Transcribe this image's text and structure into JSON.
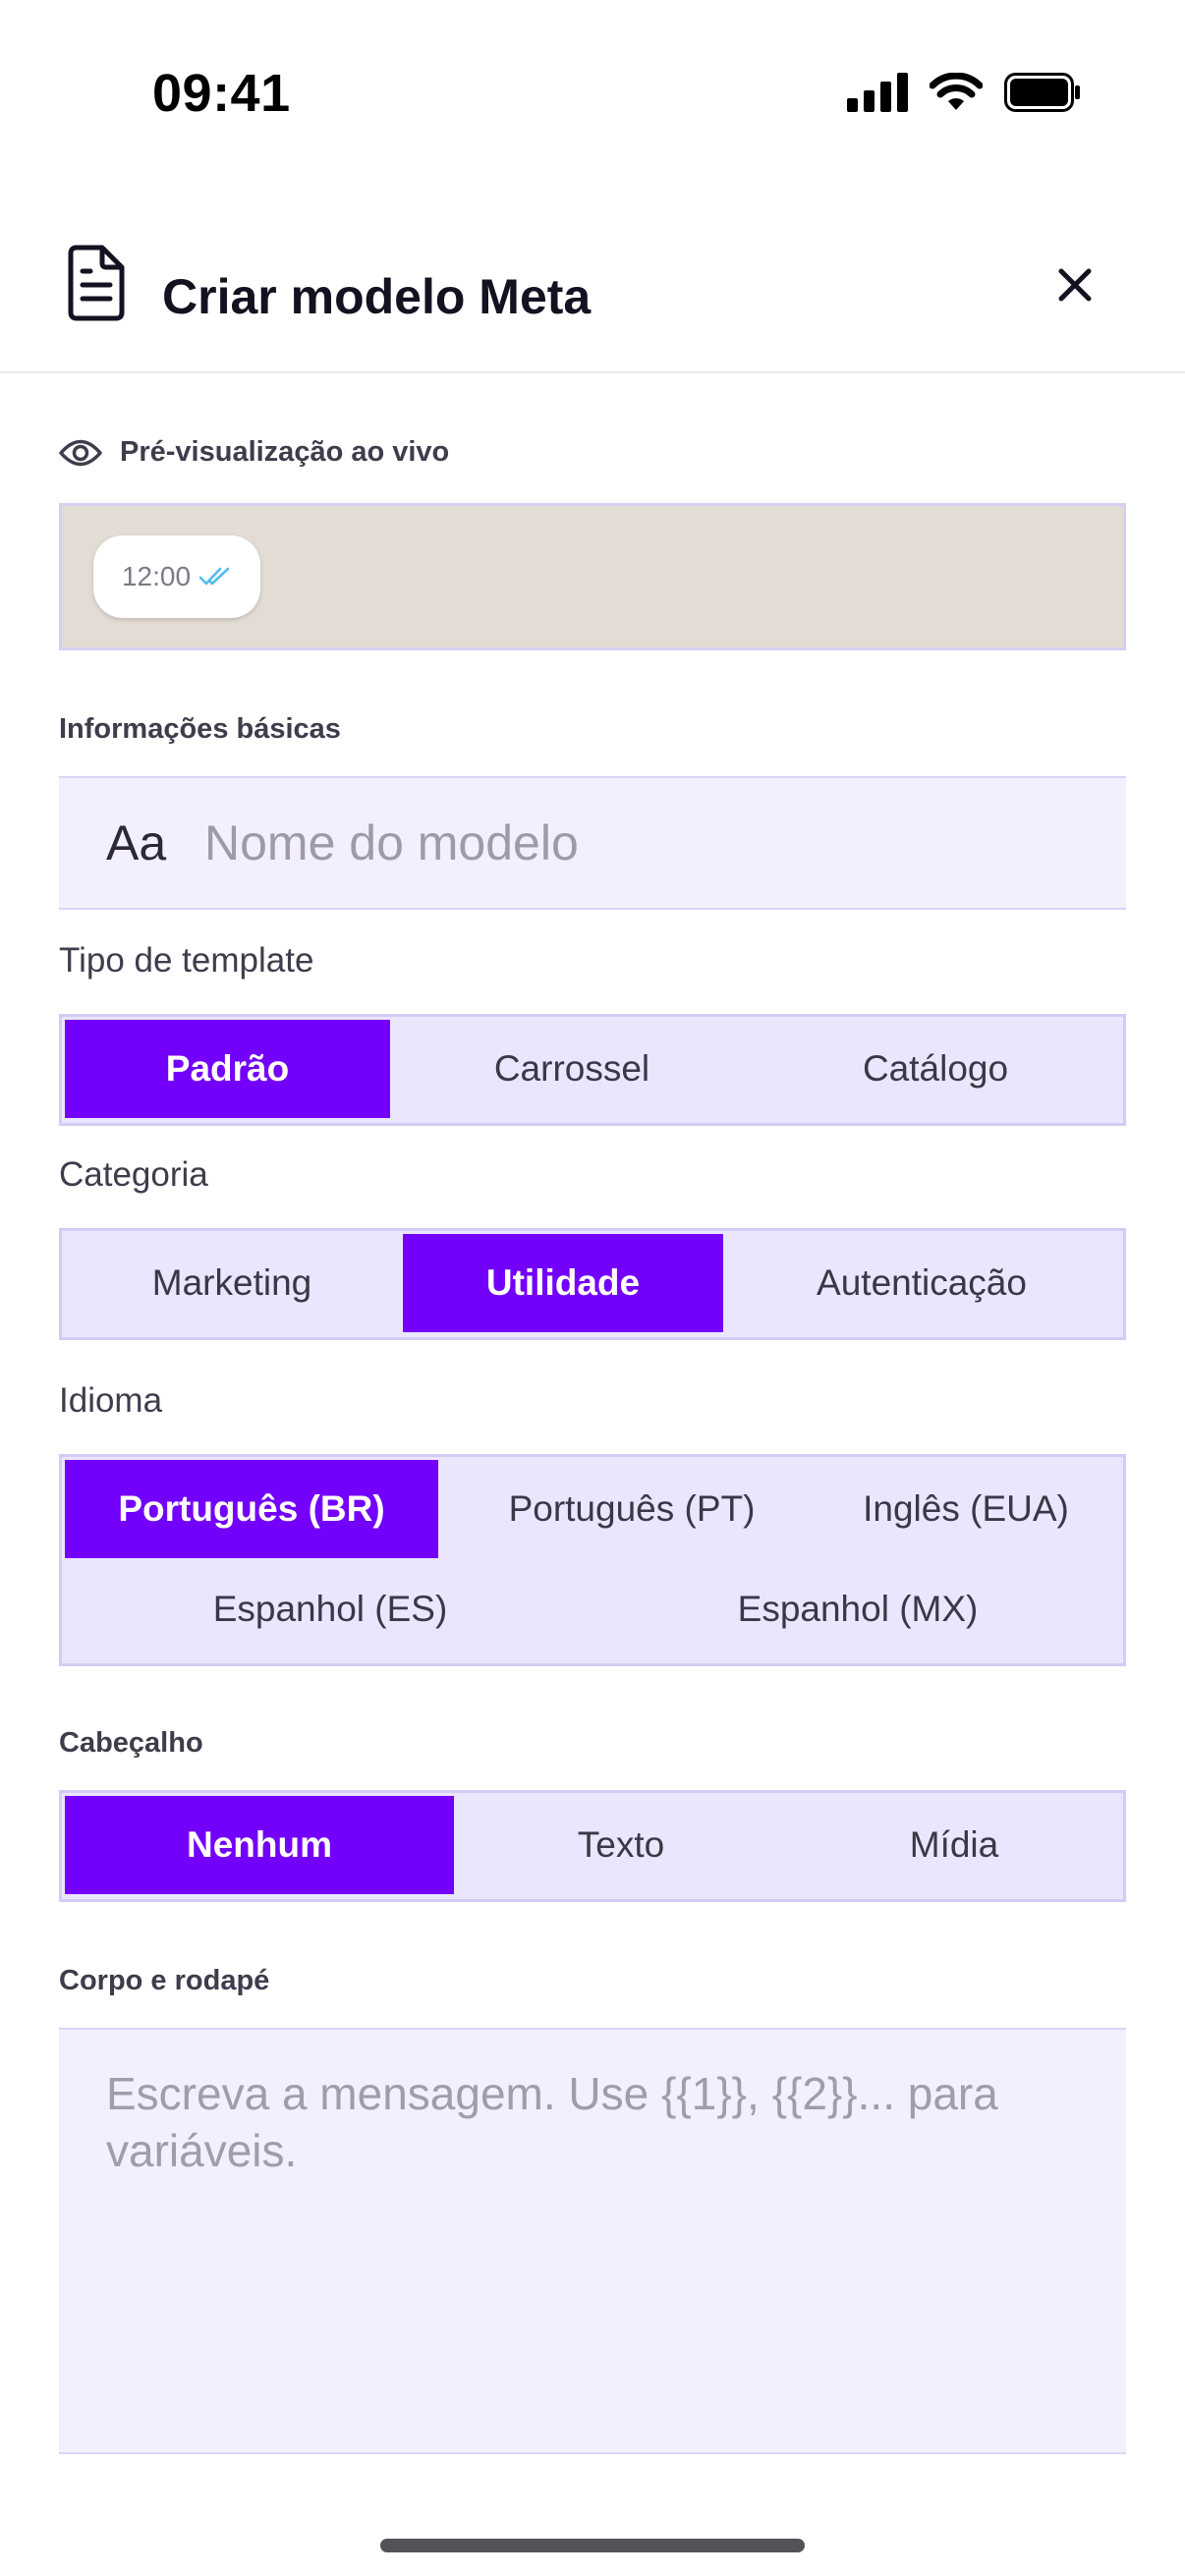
{
  "status_bar": {
    "time": "09:41",
    "icons": [
      "signal-icon",
      "wifi-icon",
      "battery-icon"
    ]
  },
  "header": {
    "title": "Criar modelo Meta",
    "icons": [
      "document-icon",
      "close-icon"
    ]
  },
  "preview": {
    "label": "Pré-visualização ao vivo",
    "bubble_time": "12:00",
    "icons": [
      "eye-icon",
      "double-check-icon"
    ]
  },
  "basic_info": {
    "label": "Informações básicas",
    "name_icon": "Aa",
    "name_placeholder": "Nome do modelo",
    "name_value": ""
  },
  "template_type": {
    "label": "Tipo de template",
    "options": [
      "Padrão",
      "Carrossel",
      "Catálogo"
    ],
    "selected": "Padrão"
  },
  "category": {
    "label": "Categoria",
    "options": [
      "Marketing",
      "Utilidade",
      "Autenticação"
    ],
    "selected": "Utilidade"
  },
  "language": {
    "label": "Idioma",
    "options": [
      "Português (BR)",
      "Português (PT)",
      "Inglês (EUA)",
      "Espanhol (ES)",
      "Espanhol (MX)"
    ],
    "selected": "Português (BR)"
  },
  "header_section": {
    "label": "Cabeçalho",
    "options": [
      "Nenhum",
      "Texto",
      "Mídia"
    ],
    "selected": "Nenhum"
  },
  "body_footer": {
    "label": "Corpo e rodapé",
    "placeholder": "Escreva a mensagem. Use {{1}}, {{2}}... para variáveis.",
    "value": ""
  },
  "colors": {
    "accent": "#7300fa",
    "segment_bg": "#eae6fd",
    "input_bg": "#f4effe",
    "preview_bg": "#e3dcd4",
    "check_blue": "#53bdeb"
  }
}
